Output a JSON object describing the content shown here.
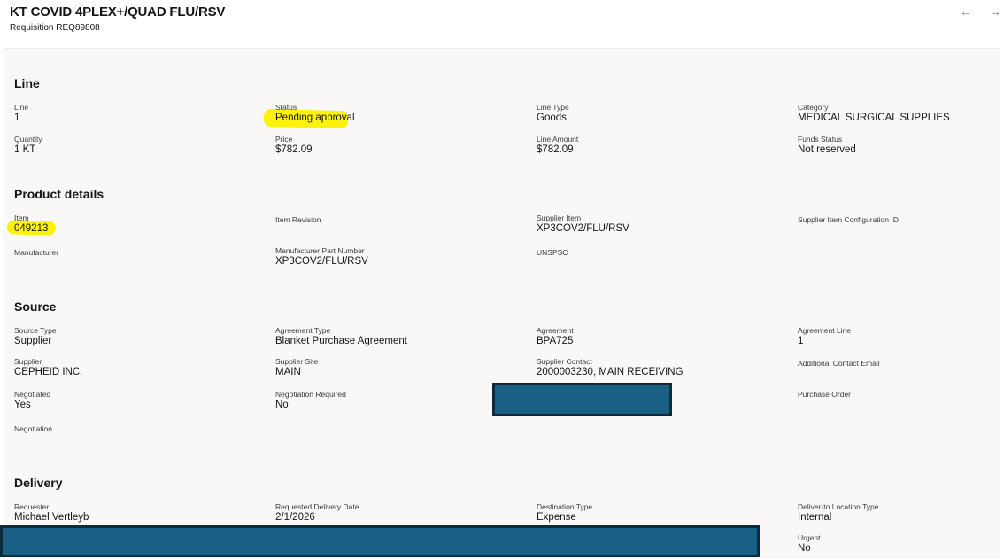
{
  "header": {
    "title": "KT COVID 4PLEX+/QUAD FLU/RSV",
    "subtitle": "Requisition REQ89808",
    "prev_icon": "arrow-left-icon",
    "next_icon": "arrow-right-icon"
  },
  "line": {
    "heading": "Line",
    "line_label": "Line",
    "line_value": "1",
    "status_label": "Status",
    "status_value": "Pending approval",
    "line_type_label": "Line Type",
    "line_type_value": "Goods",
    "category_label": "Category",
    "category_value": "MEDICAL SURGICAL SUPPLIES",
    "quantity_label": "Quantity",
    "quantity_value": "1 KT",
    "price_label": "Price",
    "price_value": "$782.09",
    "line_amount_label": "Line Amount",
    "line_amount_value": "$782.09",
    "funds_status_label": "Funds Status",
    "funds_status_value": "Not reserved"
  },
  "product": {
    "heading": "Product details",
    "item_label": "Item",
    "item_value": "049213",
    "item_revision_label": "Item Revision",
    "supplier_item_label": "Supplier Item",
    "supplier_item_value": "XP3COV2/FLU/RSV",
    "supplier_item_config_label": "Supplier Item Configuration ID",
    "manufacturer_label": "Manufacturer",
    "mfr_part_label": "Manufacturer Part Number",
    "mfr_part_value": "XP3COV2/FLU/RSV",
    "unspsc_label": "UNSPSC"
  },
  "source": {
    "heading": "Source",
    "source_type_label": "Source Type",
    "source_type_value": "Supplier",
    "agreement_type_label": "Agreement Type",
    "agreement_type_value": "Blanket Purchase Agreement",
    "agreement_label": "Agreement",
    "agreement_value": "BPA725",
    "agreement_line_label": "Agreement Line",
    "agreement_line_value": "1",
    "supplier_label": "Supplier",
    "supplier_value": "CEPHEID INC.",
    "supplier_site_label": "Supplier Site",
    "supplier_site_value": "MAIN",
    "supplier_contact_label": "Supplier Contact",
    "supplier_contact_value": "2000003230, MAIN RECEIVING",
    "additional_email_label": "Additional Contact Email",
    "negotiated_label": "Negotiated",
    "negotiated_value": "Yes",
    "negotiation_required_label": "Negotiation Required",
    "negotiation_required_value": "No",
    "purchase_order_label": "Purchase Order",
    "negotiation_label": "Negotiation"
  },
  "delivery": {
    "heading": "Delivery",
    "requester_label": "Requester",
    "requester_value": "Michael Vertleyb",
    "requested_date_label": "Requested Delivery Date",
    "requested_date_value": "2/1/2026",
    "destination_type_label": "Destination Type",
    "destination_type_value": "Expense",
    "deliver_to_type_label": "Deliver-to Location Type",
    "deliver_to_type_value": "Internal",
    "urgent_label": "Urgent",
    "urgent_value": "No"
  },
  "colors": {
    "highlight": "#fbf10a",
    "redaction": "#1a5f85"
  }
}
